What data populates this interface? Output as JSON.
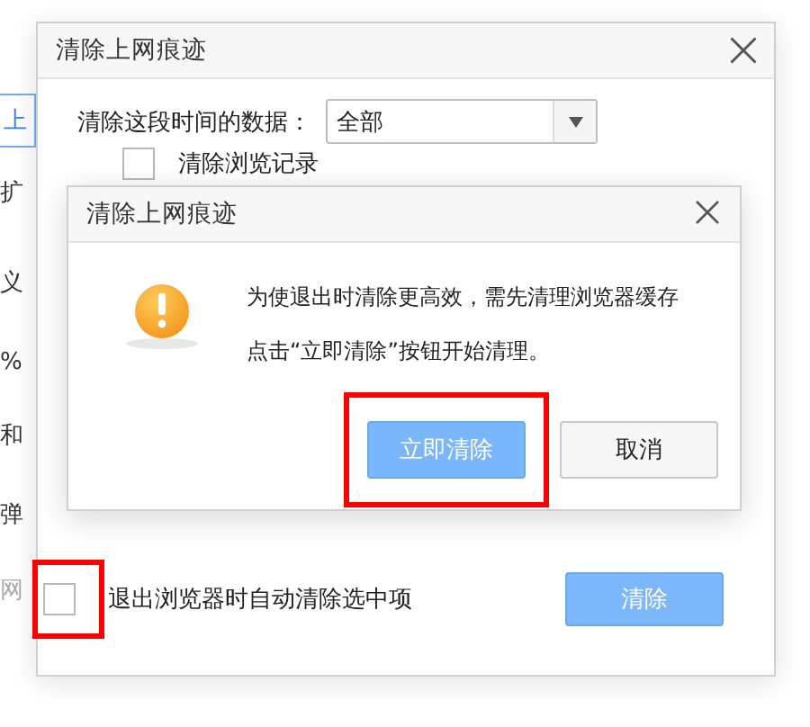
{
  "background_page": {
    "items": [
      {
        "text": "上",
        "kind": "tab"
      },
      {
        "text": "扩",
        "kind": "text"
      },
      {
        "text": "义",
        "kind": "text"
      },
      {
        "text": "%",
        "kind": "text"
      },
      {
        "text": "和",
        "kind": "text"
      },
      {
        "text": "弹",
        "kind": "text"
      },
      {
        "text": "网",
        "kind": "muted"
      }
    ]
  },
  "dialog": {
    "title": "清除上网痕迹",
    "time_range": {
      "label": "清除这段时间的数据：",
      "value": "全部"
    },
    "options": [
      {
        "label": "清除浏览记录",
        "checked": false
      }
    ],
    "auto_clear": {
      "label": "退出浏览器时自动清除选中项",
      "checked": false,
      "highlighted": true
    },
    "clear_button": "清除"
  },
  "confirm_dialog": {
    "title": "清除上网痕迹",
    "message_lines": [
      "为使退出时清除更高效，需先清理浏览器缓存",
      "点击“立即清除”按钮开始清理。"
    ],
    "buttons": [
      {
        "label": "立即清除",
        "kind": "primary",
        "highlighted": true
      },
      {
        "label": "取消",
        "kind": "secondary",
        "highlighted": false
      }
    ]
  }
}
